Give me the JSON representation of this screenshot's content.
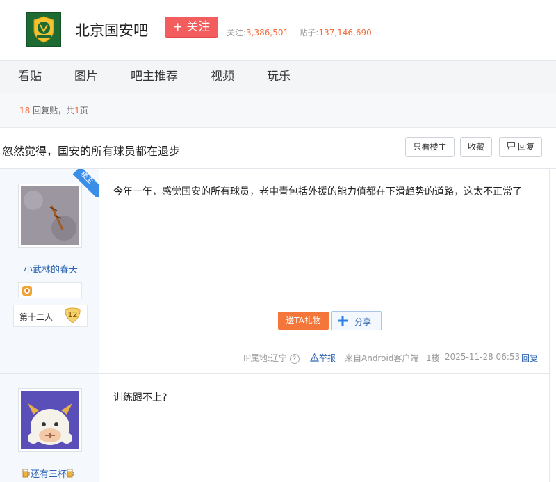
{
  "forum": {
    "name": "北京国安吧",
    "follow_label": "+ 关注",
    "followers_label": "关注:",
    "followers": "3,386,501",
    "posts_label": "贴子:",
    "posts": "137,146,690"
  },
  "nav": [
    "看贴",
    "图片",
    "吧主推荐",
    "视频",
    "玩乐"
  ],
  "summary": {
    "replies": "18",
    "replies_label": "回复贴，共",
    "pages": "1",
    "pages_suffix": "页"
  },
  "thread": {
    "title": "忽然觉得，国安的所有球员都在退步",
    "only_op_label": "只看楼主",
    "favorite_label": "收藏",
    "reply_label": "回复"
  },
  "posts": [
    {
      "badge": "楼主",
      "author": "小武林的春天",
      "rank_title": "第十二人",
      "level": "12",
      "content": "今年一年，感觉国安的所有球员，老中青包括外援的能力值都在下滑趋势的道路，这太不正常了",
      "gift_label": "送TA礼物",
      "share_label": "分享",
      "ip_label": "IP属地:辽宁",
      "report_label": "举报",
      "client_label": "来自Android客户端",
      "floor": "1楼",
      "time": "2025-11-28 06:53",
      "reply_label": "回复"
    },
    {
      "author": "还有三杯",
      "content": "训练跟不上?"
    }
  ],
  "colors": {
    "accent": "#f36b3b",
    "follow": "#f35d5d",
    "link": "#2d64b3",
    "badge": "#3b8ee8"
  }
}
